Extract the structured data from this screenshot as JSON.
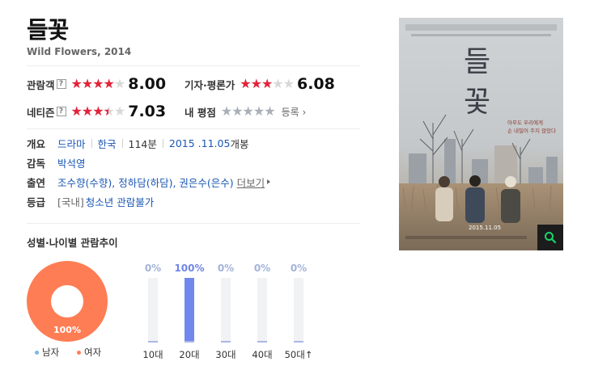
{
  "movie": {
    "title": "들꽃",
    "subtitle_en": "Wild Flowers",
    "year": "2014"
  },
  "ratings": {
    "audience": {
      "label": "관람객",
      "help": "?",
      "score": "8.00",
      "stars_fraction": 0.8
    },
    "critic": {
      "label": "기자·평론가",
      "score": "6.08",
      "stars_fraction": 0.608
    },
    "netizen": {
      "label": "네티즌",
      "help": "?",
      "score": "7.03",
      "stars_fraction": 0.703
    },
    "my": {
      "label": "내 평점",
      "stars_fraction": 0.0,
      "register_label": "등록"
    }
  },
  "info": {
    "overview_label": "개요",
    "genre": "드라마",
    "country": "한국",
    "runtime": "114분",
    "release_date": "2015 .11.05",
    "release_suffix": "개봉",
    "director_label": "감독",
    "director": "박석영",
    "cast_label": "출연",
    "cast": "조수향(수향), 정하담(하담), 권은수(은수)",
    "more_label": "더보기",
    "grade_label": "등급",
    "grade_prefix": "[국내]",
    "grade": "청소년 관람불가"
  },
  "audience_trend": {
    "title": "성별·나이별 관람추이",
    "gender": {
      "male_label": "남자",
      "female_label": "여자",
      "female_pct": "100%",
      "male_color": "#7bb6ea",
      "female_color": "#ff7d54"
    },
    "ages": [
      {
        "label": "10대",
        "pct": "0%",
        "value": 0
      },
      {
        "label": "20대",
        "pct": "100%",
        "value": 100
      },
      {
        "label": "30대",
        "pct": "0%",
        "value": 0
      },
      {
        "label": "40대",
        "pct": "0%",
        "value": 0
      },
      {
        "label": "50대↑",
        "pct": "0%",
        "value": 0
      }
    ]
  },
  "poster": {
    "title_text": "들꽃",
    "tagline": "아무도 우리에게 손 내밀어 주지 않았다",
    "date": "2015.11.05",
    "search_icon": "search-icon"
  },
  "colors": {
    "star_red": "#e3233a",
    "link_blue": "#1a57b3",
    "age_bar": "#7088ee"
  }
}
